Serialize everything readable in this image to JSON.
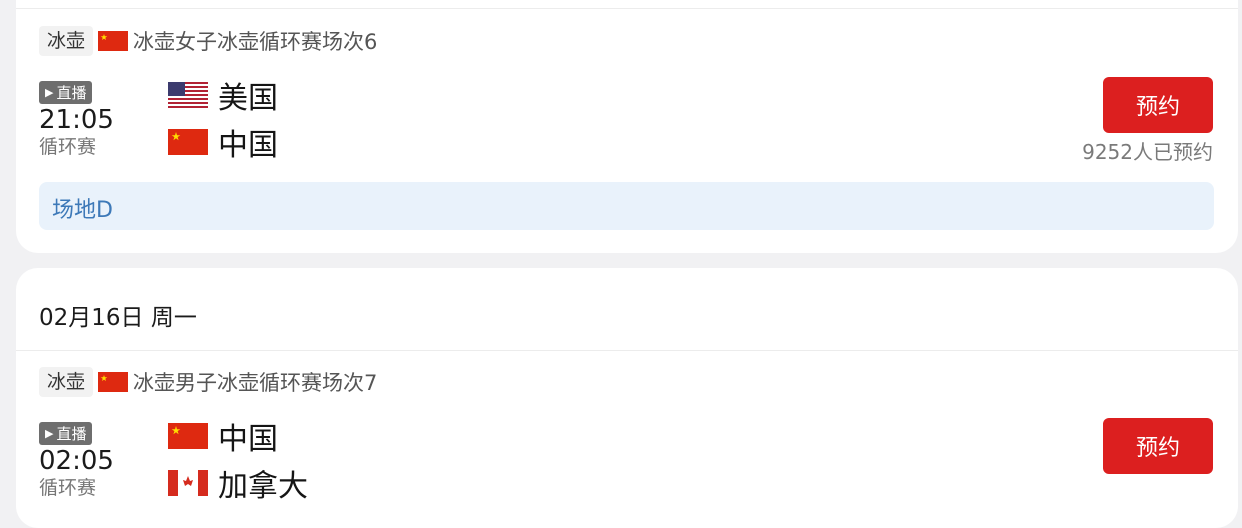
{
  "matches": [
    {
      "sport": "冰壶",
      "event": "冰壶女子冰壶循环赛场次6",
      "live_label": "直播",
      "time": "21:05",
      "stage": "循环赛",
      "team_a": "美国",
      "team_b": "中国",
      "book_label": "预约",
      "book_count": "9252人已预约",
      "venue": "场地D"
    },
    {
      "sport": "冰壶",
      "event": "冰壶男子冰壶循环赛场次7",
      "live_label": "直播",
      "time": "02:05",
      "stage": "循环赛",
      "team_a": "中国",
      "team_b": "加拿大",
      "book_label": "预约"
    }
  ],
  "date_header": "02月16日 周一",
  "colors": {
    "book_button": "#dc1f1f",
    "venue_bg": "#e9f2fb",
    "venue_text": "#3d79b8"
  }
}
